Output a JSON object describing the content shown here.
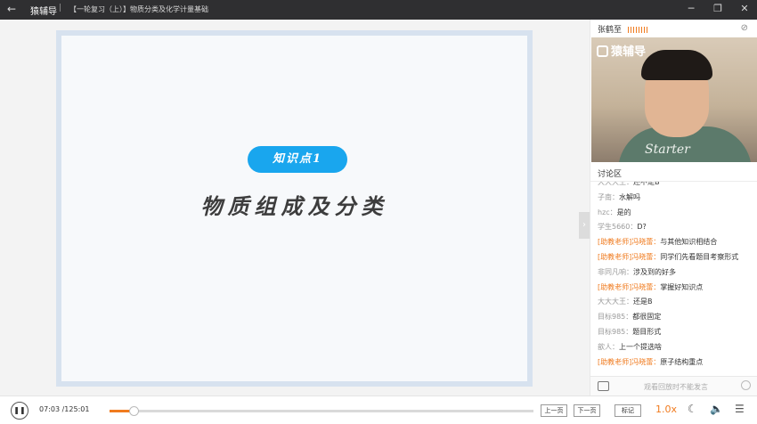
{
  "titlebar": {
    "app_name": "猿辅导",
    "separator": "|",
    "lesson_title": "【一轮复习（上）】物质分类及化学计量基础"
  },
  "slide": {
    "badge": "知识点1",
    "title": "物质组成及分类"
  },
  "teacher": {
    "name": "张鹤至"
  },
  "webcam": {
    "logo": "猿辅导",
    "shirt_text": "Starter"
  },
  "discussion": {
    "title": "讨论区",
    "messages": [
      {
        "user": "大大大王：",
        "text": "还不走B",
        "teacher": false
      },
      {
        "user": "子南：",
        "text": "水解吗",
        "teacher": false
      },
      {
        "user": "hzc：",
        "text": "是的",
        "teacher": false
      },
      {
        "user": "学生5660：",
        "text": "D?",
        "teacher": false
      },
      {
        "user": "[助教老师]冯晓蕾：",
        "text": "与其他知识相结合",
        "teacher": true
      },
      {
        "user": "[助教老师]冯晓蕾：",
        "text": "同学们先看题目考察形式",
        "teacher": true
      },
      {
        "user": "非同凡响：",
        "text": "涉及到的好多",
        "teacher": false
      },
      {
        "user": "[助教老师]冯晓蕾：",
        "text": "掌握好知识点",
        "teacher": true
      },
      {
        "user": "大大大王：",
        "text": "还是B",
        "teacher": false
      },
      {
        "user": "目标985：",
        "text": "都很固定",
        "teacher": false
      },
      {
        "user": "目标985：",
        "text": "题目形式",
        "teacher": false
      },
      {
        "user": "歆人：",
        "text": "上一个提选啥",
        "teacher": false
      },
      {
        "user": "[助教老师]冯晓蕾：",
        "text": "原子结构重点",
        "teacher": true
      }
    ],
    "input_hint": "观看回放时不能发言"
  },
  "controls": {
    "current_time": "07:03",
    "total_time": "/125:01",
    "progress": 0.056,
    "prev_label": "上一页",
    "next_label": "下一页",
    "mark_label": "标记",
    "speed": "1.0x"
  },
  "colors": {
    "accent": "#f07b1f",
    "badge": "#19a6ee",
    "titlebar": "#2f2f31"
  }
}
